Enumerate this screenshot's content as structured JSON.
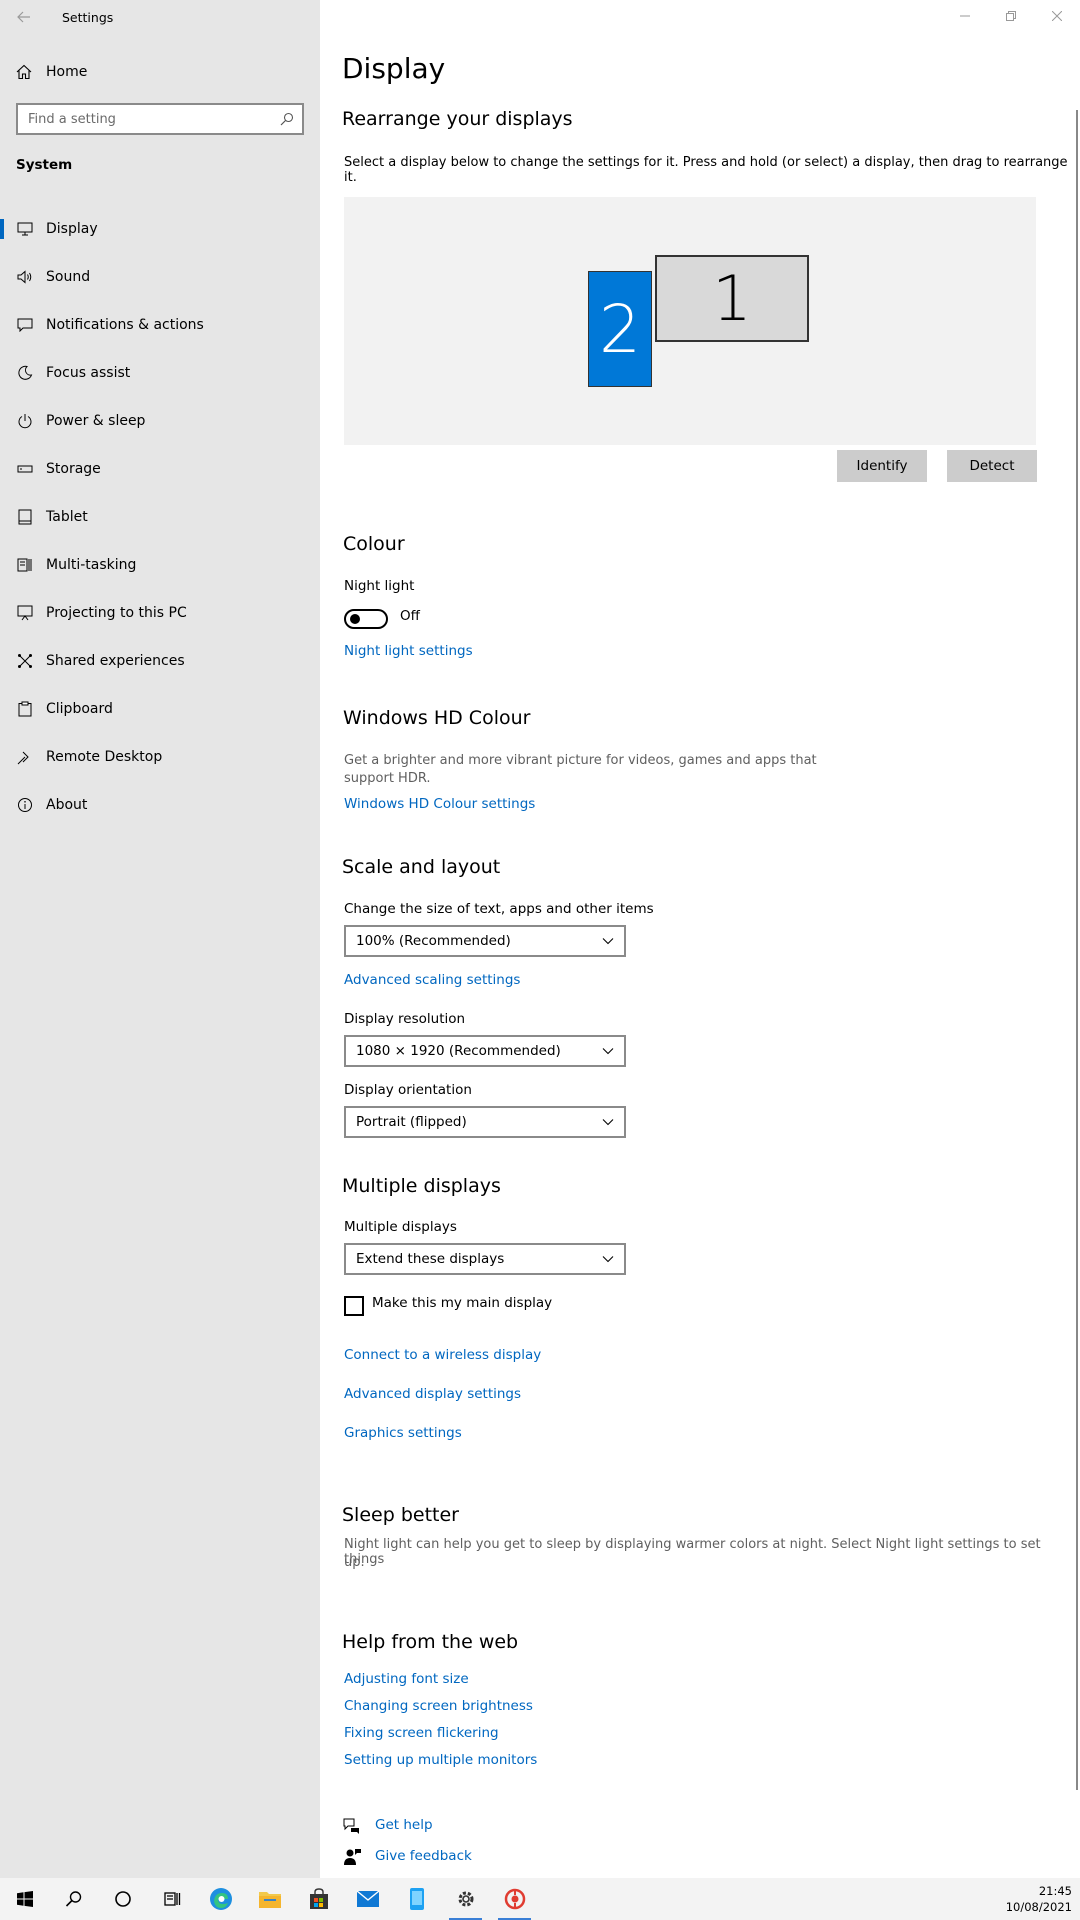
{
  "window": {
    "title": "Settings"
  },
  "sidebar": {
    "home_label": "Home",
    "search_placeholder": "Find a setting",
    "section_title": "System",
    "items": [
      {
        "label": "Display",
        "icon": "monitor-icon",
        "active": true
      },
      {
        "label": "Sound",
        "icon": "speaker-icon"
      },
      {
        "label": "Notifications & actions",
        "icon": "notification-icon"
      },
      {
        "label": "Focus assist",
        "icon": "moon-icon"
      },
      {
        "label": "Power & sleep",
        "icon": "power-icon"
      },
      {
        "label": "Storage",
        "icon": "storage-icon"
      },
      {
        "label": "Tablet",
        "icon": "tablet-icon"
      },
      {
        "label": "Multi-tasking",
        "icon": "multitasking-icon"
      },
      {
        "label": "Projecting to this PC",
        "icon": "projector-icon"
      },
      {
        "label": "Shared experiences",
        "icon": "shared-icon"
      },
      {
        "label": "Clipboard",
        "icon": "clipboard-icon"
      },
      {
        "label": "Remote Desktop",
        "icon": "remote-desktop-icon"
      },
      {
        "label": "About",
        "icon": "info-icon"
      }
    ]
  },
  "main": {
    "page_title": "Display",
    "rearrange": {
      "heading": "Rearrange your displays",
      "description": "Select a display below to change the settings for it. Press and hold (or select) a display, then drag to rearrange it.",
      "monitor_primary": "1",
      "monitor_secondary": "2",
      "identify_label": "Identify",
      "detect_label": "Detect"
    },
    "colour": {
      "heading": "Colour",
      "night_light_label": "Night light",
      "night_light_state": "Off",
      "night_light_settings_link": "Night light settings"
    },
    "hd_colour": {
      "heading": "Windows HD Colour",
      "description_line1": "Get a brighter and more vibrant picture for videos, games and apps that",
      "description_line2": "support HDR.",
      "settings_link": "Windows HD Colour settings"
    },
    "scale": {
      "heading": "Scale and layout",
      "size_label": "Change the size of text, apps and other items",
      "size_value": "100% (Recommended)",
      "advanced_scaling_link": "Advanced scaling settings",
      "resolution_label": "Display resolution",
      "resolution_value": "1080 × 1920 (Recommended)",
      "orientation_label": "Display orientation",
      "orientation_value": "Portrait (flipped)"
    },
    "multiple": {
      "heading": "Multiple displays",
      "label": "Multiple displays",
      "value": "Extend these displays",
      "main_display_checkbox": "Make this my main display",
      "wireless_link": "Connect to a wireless display",
      "advanced_display_link": "Advanced display settings",
      "graphics_link": "Graphics settings"
    },
    "sleep": {
      "heading": "Sleep better",
      "description_line1": "Night light can help you get to sleep by displaying warmer colors at night. Select Night light settings to set things",
      "description_line2": "up."
    },
    "help": {
      "heading": "Help from the web",
      "links": [
        "Adjusting font size",
        "Changing screen brightness",
        "Fixing screen flickering",
        "Setting up multiple monitors"
      ],
      "get_help": "Get help",
      "give_feedback": "Give feedback"
    }
  },
  "taskbar": {
    "time": "21:45",
    "date": "10/08/2021"
  },
  "colors": {
    "accent": "#0067c0",
    "selected_monitor": "#0078d7",
    "sidebar_bg": "#e6e6e6"
  }
}
